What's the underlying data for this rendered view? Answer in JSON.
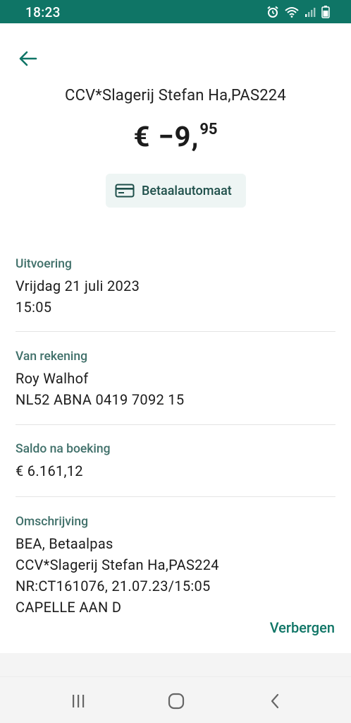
{
  "status_bar": {
    "time": "18:23",
    "icons": [
      "alarm-icon",
      "wifi-icon",
      "signal-icon",
      "battery-icon"
    ]
  },
  "header": {
    "back_icon": "arrow-left-icon"
  },
  "transaction": {
    "merchant": "CCV*Slagerij Stefan Ha,PAS224",
    "amount_main": "€ −9,",
    "amount_cents": "95",
    "type_icon": "card-icon",
    "type_label": "Betaalautomaat"
  },
  "details": {
    "execution": {
      "title": "Uitvoering",
      "lines": [
        "Vrijdag 21 juli 2023",
        "15:05"
      ]
    },
    "from_account": {
      "title": "Van rekening",
      "lines": [
        "Roy Walhof",
        "NL52 ABNA 0419 7092 15"
      ]
    },
    "balance": {
      "title": "Saldo na boeking",
      "lines": [
        "€ 6.161,12"
      ]
    },
    "description": {
      "title": "Omschrijving",
      "lines": [
        "BEA, Betaalpas",
        "CCV*Slagerij Stefan Ha,PAS224",
        "NR:CT161076, 21.07.23/15:05",
        "CAPELLE AAN D"
      ]
    },
    "hide_label": "Verbergen"
  },
  "nav_bar": {
    "icons": [
      "recent-apps-icon",
      "home-icon",
      "back-icon"
    ]
  },
  "colors": {
    "brand": "#0f7566",
    "section_title": "#40706a",
    "chip_bg": "#eef5f4"
  }
}
